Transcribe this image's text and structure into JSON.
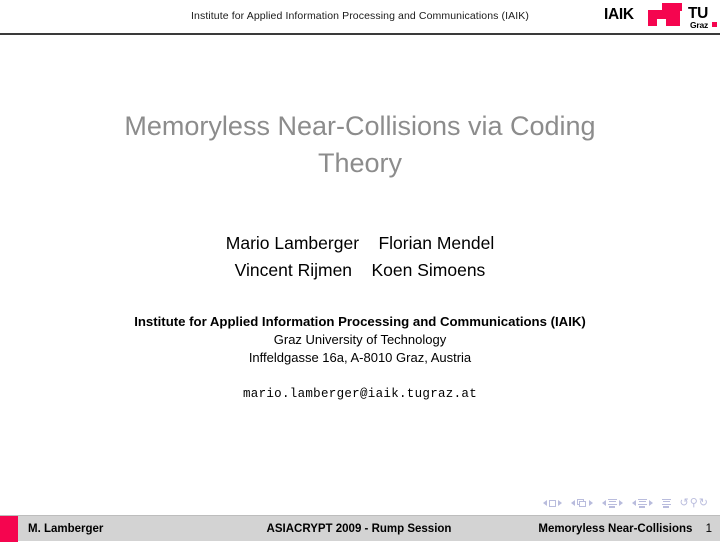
{
  "header": {
    "institute_line": "Institute for Applied Information Processing and Communications (IAIK)",
    "logo": {
      "iaik_text": "IAIK",
      "tu_text": "TU",
      "graz_text": "Graz",
      "mark_color": "#f5054f"
    }
  },
  "slide": {
    "title_line1": "Memoryless Near-Collisions via Coding",
    "title_line2": "Theory",
    "title_color": "#8c8c8c",
    "authors": [
      "Mario Lamberger    Florian Mendel",
      "Vincent Rijmen    Koen Simoens"
    ],
    "affiliation": {
      "line1": "Institute for Applied Information Processing and Communications (IAIK)",
      "line2": "Graz University of Technology",
      "line3": "Inffeldgasse 16a, A-8010 Graz, Austria"
    },
    "email": "mario.lamberger@iaik.tugraz.at"
  },
  "navigation": {
    "symbol_color": "#b9bcdd",
    "groups": [
      {
        "name": "slide-nav",
        "icon": "square-icon"
      },
      {
        "name": "frame-nav",
        "icon": "cards-icon"
      },
      {
        "name": "subsection-nav",
        "icon": "lines-icon"
      },
      {
        "name": "section-nav",
        "icon": "lines-icon"
      }
    ],
    "doc_icon": "document-lines-icon",
    "back_arrow": "↺",
    "search_glyph": "⚲",
    "forward_arrow": "↻"
  },
  "footer": {
    "accent_color": "#f5054f",
    "author": "M. Lamberger",
    "event": "ASIACRYPT 2009 - Rump Session",
    "short_title": "Memoryless Near-Collisions",
    "page_number": "1"
  }
}
